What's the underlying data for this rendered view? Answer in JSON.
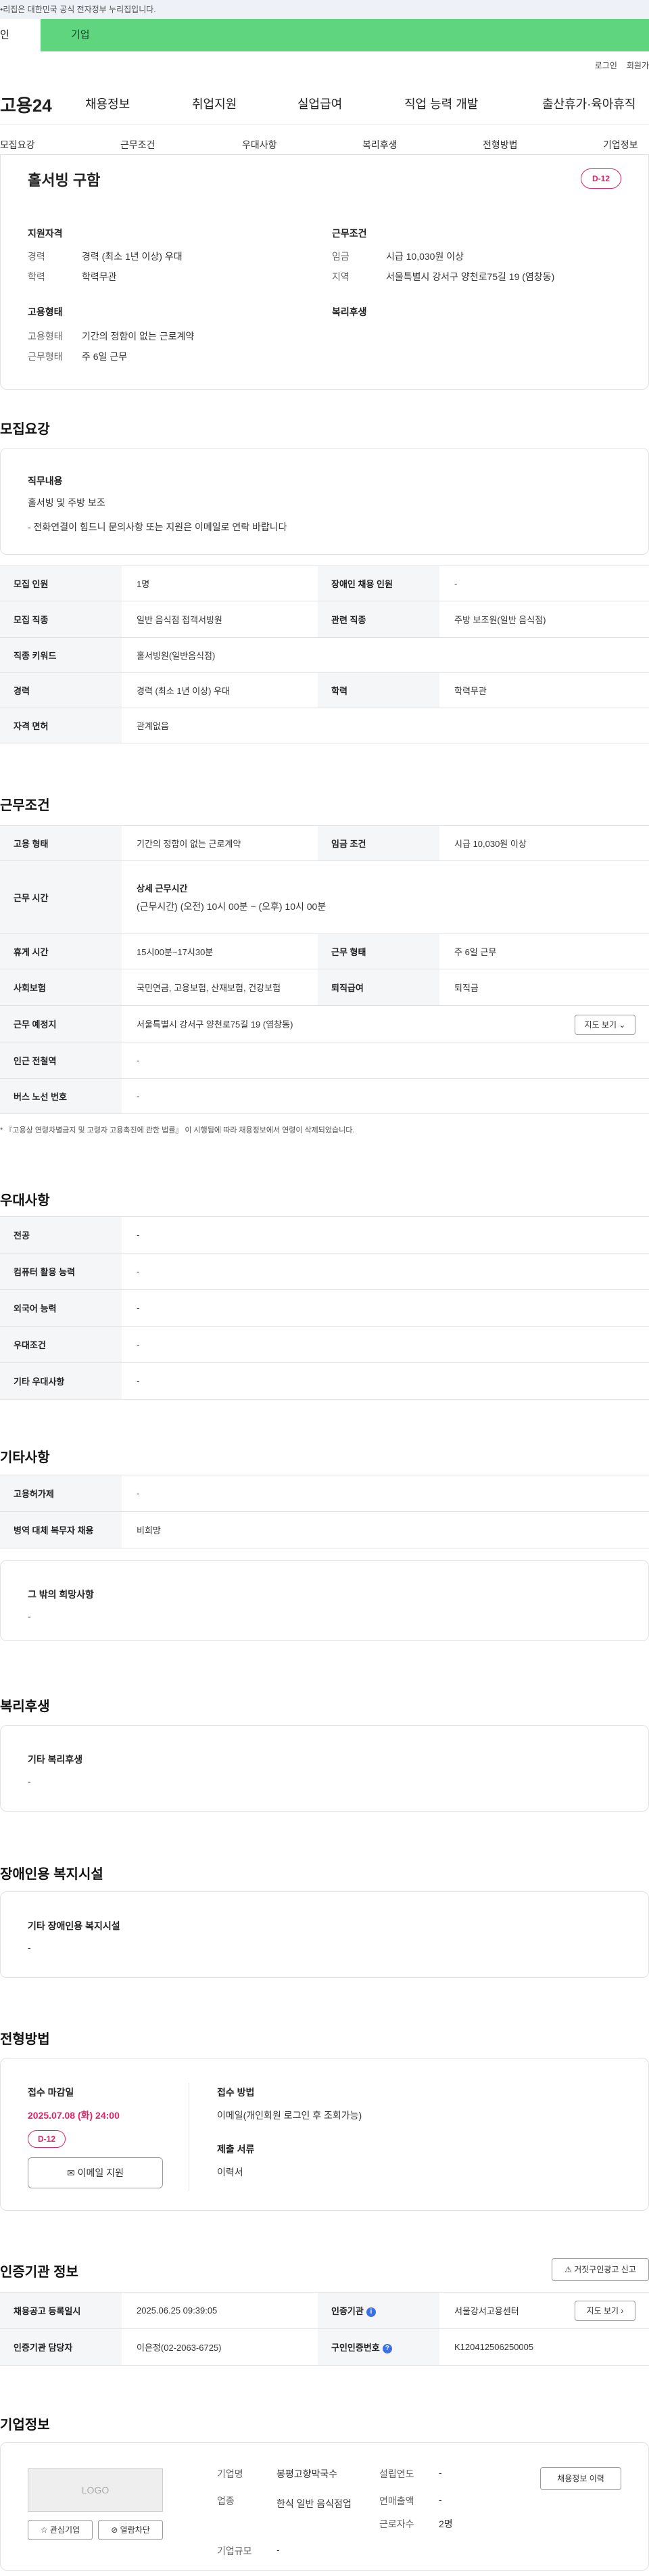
{
  "banner": {
    "text": "•리집은 대한민국 공식 전자정부 누리집입니다."
  },
  "user_tabs": {
    "personal": "인",
    "company": "기업"
  },
  "util": {
    "login": "로그인",
    "signup": "회원가"
  },
  "gnb": {
    "logo": "고용24",
    "items": [
      "채용정보",
      "취업지원",
      "실업급여",
      "직업 능력 개발",
      "출산휴가·육아휴직"
    ]
  },
  "anchors": [
    "모집요강",
    "근무조건",
    "우대사항",
    "복리후생",
    "전형방법",
    "기업정보"
  ],
  "summary": {
    "title": "홀서빙 구함",
    "dday": "D-12",
    "qualification": {
      "heading": "지원자격",
      "career_label": "경력",
      "career_value": "경력 (최소 1년 이상) 우대",
      "edu_label": "학력",
      "edu_value": "학력무관"
    },
    "conditions": {
      "heading": "근무조건",
      "wage_label": "임금",
      "wage_value": "시급 10,030원 이상",
      "region_label": "지역",
      "region_value": "서울특별시 강서구 양천로75길 19 (염창동)"
    },
    "employment": {
      "heading": "고용형태",
      "type_label": "고용형태",
      "type_value": "기간의 정함이 없는 근로계약",
      "days_label": "근무형태",
      "days_value": "주 6일 근무"
    },
    "welfare": {
      "heading": "복리후생"
    }
  },
  "recruit": {
    "title": "모집요강",
    "duty_label": "직무내용",
    "duty_line1": "홀서빙 및 주방 보조",
    "duty_line2": "- 전화연결이 힘드니 문의사항 또는 지원은 이메일로 연락 바랍니다",
    "rows": {
      "count_label": "모집 인원",
      "count_value": "1명",
      "disabled_label": "장애인 채용 인원",
      "disabled_value": "-",
      "job_label": "모집 직종",
      "job_value": "일반 음식점 접객서빙원",
      "related_label": "관련 직종",
      "related_value": "주방 보조원(일반 음식점)",
      "keyword_label": "직종 키워드",
      "keyword_value": "홀서빙원(일반음식점)",
      "career_label": "경력",
      "career_value": "경력 (최소 1년 이상) 우대",
      "edu_label": "학력",
      "edu_value": "학력무관",
      "license_label": "자격 면허",
      "license_value": "관계없음"
    }
  },
  "work": {
    "title": "근무조건",
    "emp_label": "고용 형태",
    "emp_value": "기간의 정함이 없는 근로계약",
    "wage_label": "임금 조건",
    "wage_value": "시급 10,030원 이상",
    "time_label": "근무 시간",
    "time_sub": "상세 근무시간",
    "time_value": "(근무시간) (오전) 10시 00분 ~ (오후) 10시 00분",
    "break_label": "휴게 시간",
    "break_value": "15시00분~17시30분",
    "form_label": "근무 형태",
    "form_value": "주 6일 근무",
    "insurance_label": "사회보험",
    "insurance_value": "국민연금, 고용보험, 산재보험, 건강보험",
    "severance_label": "퇴직급여",
    "severance_value": "퇴직금",
    "place_label": "근무 예정지",
    "place_value": "서울특별시 강서구 양천로75길 19 (염창동)",
    "map_btn": "지도 보기",
    "station_label": "인근 전철역",
    "station_value": "-",
    "bus_label": "버스 노선 번호",
    "bus_value": "-",
    "note": "* 『고용상 연령차별금지 및 고령자 고용촉진에 관한 법률』 이 시행됨에 따라 채용정보에서 연령이 삭제되었습니다."
  },
  "prefer": {
    "title": "우대사항",
    "major_label": "전공",
    "major_value": "-",
    "computer_label": "컴퓨터 활용 능력",
    "computer_value": "-",
    "lang_label": "외국어 능력",
    "lang_value": "-",
    "cond_label": "우대조건",
    "cond_value": "-",
    "etc_label": "기타 우대사항",
    "etc_value": "-"
  },
  "other": {
    "title": "기타사항",
    "visa_label": "고용허가제",
    "visa_value": "-",
    "military_label": "병역 대체 복무자 채용",
    "military_value": "비희망",
    "wish_label": "그 밖의 희망사항",
    "wish_value": "-"
  },
  "benefit": {
    "title": "복리후생",
    "label": "기타 복리후생",
    "value": "-"
  },
  "disabled_fac": {
    "title": "장애인용 복지시설",
    "label": "기타 장애인용 복지시설",
    "value": "-"
  },
  "selection": {
    "title": "전형방법",
    "deadline_label": "접수 마감일",
    "deadline_value": "2025.07.08 (화) 24:00",
    "dday": "D-12",
    "email_btn": "이메일 지원",
    "method_label": "접수 방법",
    "method_value": "이메일(개인회원 로그인 후 조회가능)",
    "docs_label": "제출 서류",
    "docs_value": "이력서"
  },
  "cert": {
    "title": "인증기관 정보",
    "report_btn": "거짓구인광고 신고",
    "regdate_label": "채용공고 등록일시",
    "regdate_value": "2025.06.25 09:39:05",
    "agency_label": "인증기관",
    "agency_value": "서울강서고용센터",
    "map_btn": "지도 보기",
    "manager_label": "인증기관 담당자",
    "manager_value": "이은정(02-2063-6725)",
    "no_label": "구인인증번호",
    "no_value": "K120412506250005"
  },
  "company": {
    "title": "기업정보",
    "logo_text": "LOGO",
    "fav_btn": "관심기업",
    "block_btn": "열람차단",
    "name_label": "기업명",
    "name_value": "봉평고향막국수",
    "industry_label": "업종",
    "industry_value": "한식 일반 음식점업",
    "scale_label": "기업규모",
    "scale_value": "-",
    "founded_label": "설립연도",
    "founded_value": "-",
    "sales_label": "연매출액",
    "sales_value": "-",
    "staff_label": "근로자수",
    "staff_value": "2명",
    "history_btn": "채용정보 이력"
  }
}
